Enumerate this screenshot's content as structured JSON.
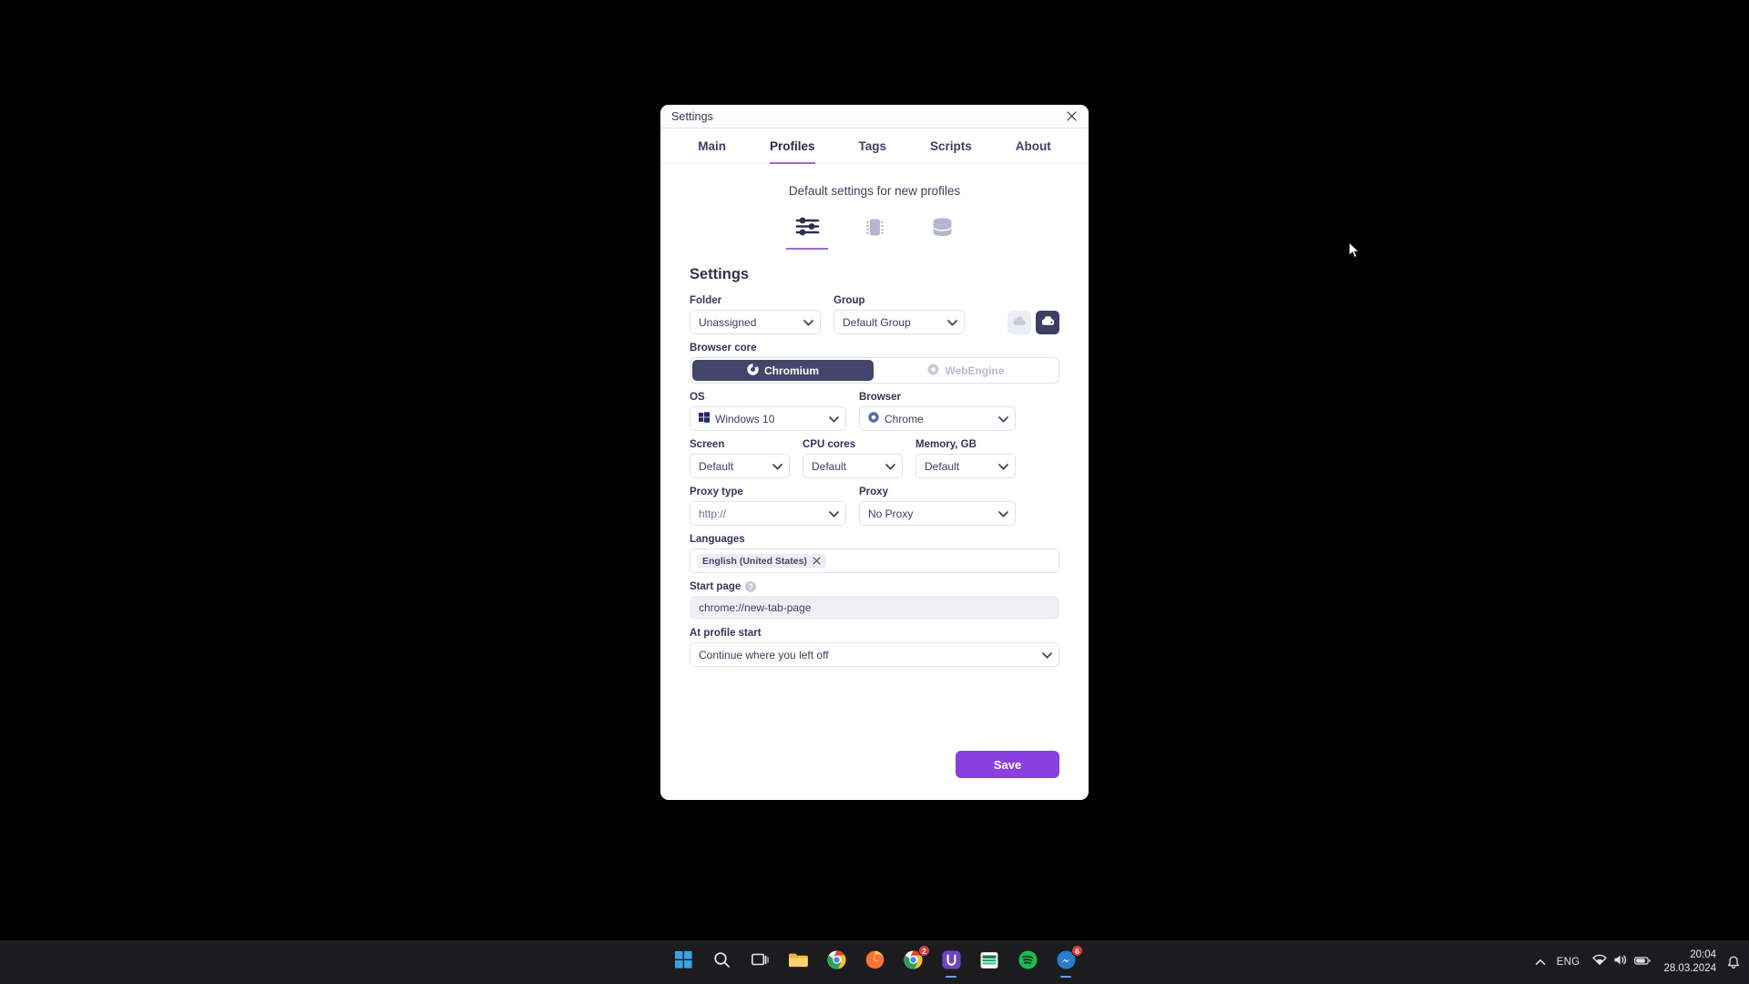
{
  "window": {
    "title": "Settings",
    "close_icon": "close-icon"
  },
  "tabs": [
    {
      "label": "Main",
      "active": false
    },
    {
      "label": "Profiles",
      "active": true
    },
    {
      "label": "Tags",
      "active": false
    },
    {
      "label": "Scripts",
      "active": false
    },
    {
      "label": "About",
      "active": false
    }
  ],
  "subtitle": "Default settings for new profiles",
  "icon_tabs": [
    {
      "icon": "sliders-icon",
      "active": true
    },
    {
      "icon": "cpu-chip-icon",
      "active": false
    },
    {
      "icon": "database-icon",
      "active": false
    }
  ],
  "section": {
    "title": "Settings"
  },
  "form": {
    "folder": {
      "label": "Folder",
      "value": "Unassigned"
    },
    "group": {
      "label": "Group",
      "value": "Default Group"
    },
    "storage_toggle": {
      "cloud": {
        "icon": "cloud-icon",
        "active": false
      },
      "local": {
        "icon": "local-disk-icon",
        "active": true
      }
    },
    "browser_core": {
      "label": "Browser core",
      "options": [
        {
          "label": "Chromium",
          "icon": "chrome-icon",
          "active": true
        },
        {
          "label": "WebEngine",
          "icon": "webengine-icon",
          "active": false
        }
      ]
    },
    "os": {
      "label": "OS",
      "value": "Windows 10",
      "icon": "windows-icon"
    },
    "browser": {
      "label": "Browser",
      "value": "Chrome",
      "icon": "chrome-icon"
    },
    "screen": {
      "label": "Screen",
      "value": "Default"
    },
    "cpu_cores": {
      "label": "CPU cores",
      "value": "Default"
    },
    "memory": {
      "label": "Memory, GB",
      "value": "Default"
    },
    "proxy_type": {
      "label": "Proxy type",
      "value": "http://"
    },
    "proxy": {
      "label": "Proxy",
      "value": "No Proxy"
    },
    "languages": {
      "label": "Languages",
      "chips": [
        {
          "label": "English (United States)",
          "remove_icon": "close-icon"
        }
      ]
    },
    "start_page": {
      "label": "Start page",
      "help_icon": "help-icon",
      "help_glyph": "?",
      "value": "chrome://new-tab-page"
    },
    "at_profile_start": {
      "label": "At profile start",
      "value": "Continue where you left off"
    }
  },
  "footer": {
    "save_label": "Save"
  },
  "colors": {
    "accent_purple": "#8b3fe0",
    "tab_underline": "#9b6cdb",
    "dark_navy": "#43456b",
    "text": "#3b3d5e"
  },
  "taskbar": {
    "items": [
      {
        "name": "start-button",
        "icon": "windows-start-icon",
        "badge": null,
        "active": false
      },
      {
        "name": "search-button",
        "icon": "search-icon",
        "badge": null,
        "active": false
      },
      {
        "name": "task-view-button",
        "icon": "task-view-icon",
        "badge": null,
        "active": false
      },
      {
        "name": "file-explorer-button",
        "icon": "folder-icon",
        "badge": null,
        "active": false
      },
      {
        "name": "chrome-button",
        "icon": "chrome-icon",
        "badge": null,
        "active": false
      },
      {
        "name": "firefox-button",
        "icon": "firefox-icon",
        "badge": null,
        "active": false
      },
      {
        "name": "chrome-profile-button",
        "icon": "chrome-icon",
        "badge": "2",
        "active": false
      },
      {
        "name": "app-button",
        "icon": "u-app-icon",
        "badge": null,
        "active": true
      },
      {
        "name": "excel-button",
        "icon": "excel-icon",
        "badge": null,
        "active": false
      },
      {
        "name": "spotify-button",
        "icon": "spotify-icon",
        "badge": null,
        "active": false
      },
      {
        "name": "messenger-button",
        "icon": "messenger-icon",
        "badge": "6",
        "active": true
      }
    ],
    "tray": {
      "chevron_icon": "chevron-up-icon",
      "language": "ENG",
      "wifi_icon": "wifi-icon",
      "volume_icon": "volume-icon",
      "battery_icon": "battery-icon",
      "time": "20:04",
      "date": "28.03.2024",
      "notification_icon": "notification-icon"
    }
  }
}
